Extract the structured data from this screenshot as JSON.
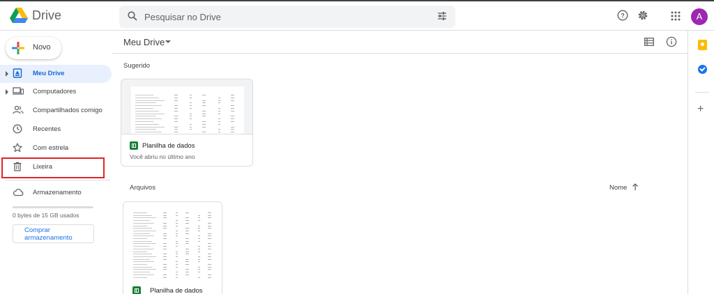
{
  "header": {
    "app_name": "Drive",
    "search_placeholder": "Pesquisar no Drive",
    "avatar_initial": "A"
  },
  "sidebar": {
    "new_label": "Novo",
    "items": [
      {
        "label": "Meu Drive",
        "icon": "my-drive-icon",
        "active": true
      },
      {
        "label": "Computadores",
        "icon": "computers-icon"
      },
      {
        "label": "Compartilhados comigo",
        "icon": "shared-icon"
      },
      {
        "label": "Recentes",
        "icon": "clock-icon"
      },
      {
        "label": "Com estrela",
        "icon": "star-icon"
      },
      {
        "label": "Lixeira",
        "icon": "trash-icon"
      },
      {
        "label": "Armazenamento",
        "icon": "cloud-icon"
      }
    ],
    "storage_text": "0 bytes de 15 GB usados",
    "storage_used_fraction": 0,
    "buy_label": "Comprar armazenamento"
  },
  "main": {
    "title": "Meu Drive",
    "suggested_label": "Sugerido",
    "suggested": [
      {
        "name": "Planilha de dados",
        "subtitle": "Você abriu no último ano"
      }
    ],
    "files_label": "Arquivos",
    "sort_label": "Nome",
    "files": [
      {
        "name": "Planilha de dados"
      }
    ]
  },
  "colors": {
    "accent": "#1a73e8",
    "active_bg": "#e8f0fe",
    "highlight_box": "#e02424",
    "sheets_green": "#188038",
    "avatar": "#9c27b0"
  }
}
